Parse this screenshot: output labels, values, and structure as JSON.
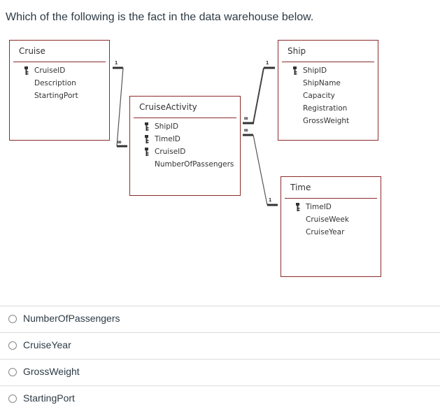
{
  "question": {
    "text": "Which of the following is the fact in the data warehouse below."
  },
  "diagram": {
    "border_color": "#8b2b2b",
    "tables": {
      "cruise": {
        "name": "Cruise",
        "fields": [
          {
            "name": "CruiseID",
            "key": true
          },
          {
            "name": "Description",
            "key": false
          },
          {
            "name": "StartingPort",
            "key": false
          }
        ]
      },
      "ship": {
        "name": "Ship",
        "fields": [
          {
            "name": "ShipID",
            "key": true
          },
          {
            "name": "ShipName",
            "key": false
          },
          {
            "name": "Capacity",
            "key": false
          },
          {
            "name": "Registration",
            "key": false
          },
          {
            "name": "GrossWeight",
            "key": false
          }
        ]
      },
      "cruise_activity": {
        "name": "CruiseActivity",
        "fields": [
          {
            "name": "ShipID",
            "key": true
          },
          {
            "name": "TimeID",
            "key": true
          },
          {
            "name": "CruiseID",
            "key": true
          },
          {
            "name": "NumberOfPassengers",
            "key": false
          }
        ]
      },
      "time": {
        "name": "Time",
        "fields": [
          {
            "name": "TimeID",
            "key": true
          },
          {
            "name": "CruiseWeek",
            "key": false
          },
          {
            "name": "CruiseYear",
            "key": false
          }
        ]
      }
    },
    "relationships": [
      {
        "from": "Cruise",
        "to": "CruiseActivity",
        "one_label": "1",
        "many_label": "∞"
      },
      {
        "from": "Ship",
        "to": "CruiseActivity",
        "one_label": "1",
        "many_label": "∞"
      },
      {
        "from": "Time",
        "to": "CruiseActivity",
        "one_label": "1",
        "many_label": "∞"
      }
    ]
  },
  "answers": [
    {
      "label": "NumberOfPassengers",
      "selected": false
    },
    {
      "label": "CruiseYear",
      "selected": false
    },
    {
      "label": "GrossWeight",
      "selected": false
    },
    {
      "label": "StartingPort",
      "selected": false
    }
  ]
}
